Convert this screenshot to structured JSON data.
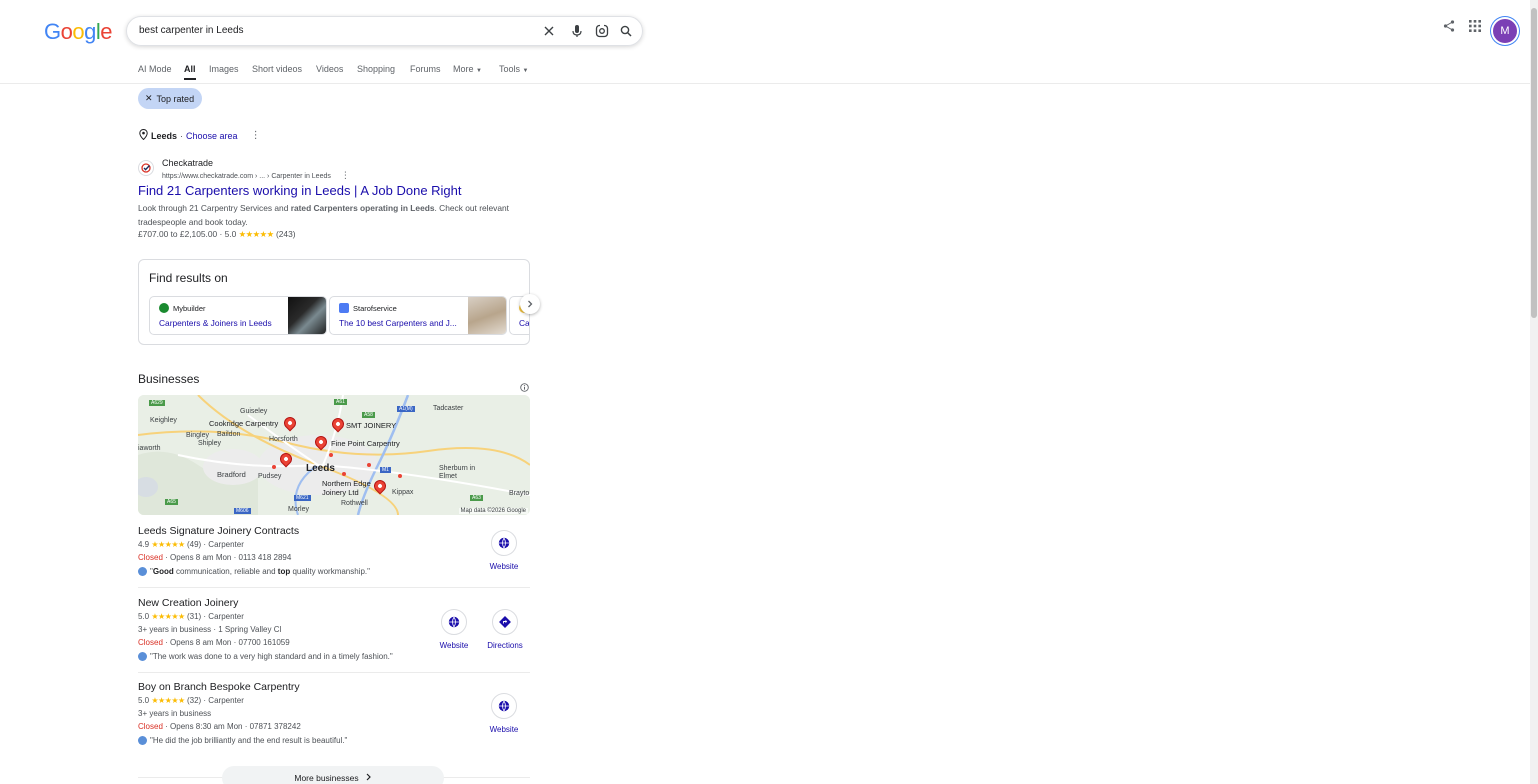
{
  "logo": {
    "text": "Google"
  },
  "search": {
    "query": "best carpenter in Leeds"
  },
  "header": {
    "avatar_letter": "M"
  },
  "tabs": [
    {
      "label": "AI Mode"
    },
    {
      "label": "All"
    },
    {
      "label": "Images"
    },
    {
      "label": "Short videos"
    },
    {
      "label": "Videos"
    },
    {
      "label": "Shopping"
    },
    {
      "label": "Forums"
    },
    {
      "label": "More"
    },
    {
      "label": "Tools"
    }
  ],
  "filter_chip": {
    "label": "Top rated"
  },
  "location": {
    "place": "Leeds",
    "separator": "·",
    "choose": "Choose area"
  },
  "result": {
    "site": "Checkatrade",
    "url": "https://www.checkatrade.com › ... › Carpenter in Leeds",
    "title": "Find 21 Carpenters working in Leeds | A Job Done Right",
    "snippet_a": "Look through 21 Carpentry Services and ",
    "snippet_b": "rated Carpenters operating in Leeds",
    "snippet_c": ". Check out relevant tradespeople and book today.",
    "price": "£707.00 to £2,105.00",
    "rating": "5.0",
    "stars": "★★★★★",
    "count": "(243)"
  },
  "find_results": {
    "title": "Find results on",
    "cards": [
      {
        "source": "Mybuilder",
        "link": "Carpenters & Joiners in Leeds"
      },
      {
        "source": "Starofservice",
        "link": "The 10 best Carpenters and J..."
      },
      {
        "source": "",
        "link": "Ca"
      }
    ]
  },
  "businesses": {
    "title": "Businesses",
    "map_copyright": "Map data ©2026 Google",
    "map_labels": {
      "keighley": "Keighley",
      "guiseley": "Guiseley",
      "cookridge": "Cookridge Carpentry",
      "bingley": "Bingley",
      "baildon": "Baildon",
      "horsforth": "Horsforth",
      "shipley": "Shipley",
      "haworth": "iaworth",
      "bradford": "Bradford",
      "pudsey": "Pudsey",
      "leeds": "Leeds",
      "smt": "SMT JOINERY",
      "finepoint": "Fine Point Carpentry",
      "northern": "Northern Edge Joinery Ltd",
      "kippax": "Kippax",
      "tadcaster": "Tadcaster",
      "sherburn": "Sherburn in Elmet",
      "rothwell": "Rothwell",
      "morley": "Morley",
      "brayton": "Brayto",
      "a660": "A660",
      "a65": "A65",
      "a61": "A61",
      "a58": "A58",
      "a1m": "A1(M)",
      "m1": "M1",
      "m621": "M621",
      "a64": "A64",
      "a629": "A629",
      "m606": "M606",
      "a63": "A63"
    },
    "list": [
      {
        "name": "Leeds Signature Joinery Contracts",
        "rating": "4.9",
        "stars": "★★★★★",
        "count": "(49)",
        "category": "Carpenter",
        "extra": "",
        "status": "Closed",
        "hours": "Opens 8 am Mon",
        "phone": "0113 418 2894",
        "review_a": "\"",
        "review_b1": "Good",
        "review_mid": " communication, reliable and ",
        "review_b2": "top",
        "review_end": " quality workmanship.\"",
        "website": "Website"
      },
      {
        "name": "New Creation Joinery",
        "rating": "5.0",
        "stars": "★★★★★",
        "count": "(31)",
        "category": "Carpenter",
        "extra": "3+ years in business · 1 Spring Valley Cl",
        "status": "Closed",
        "hours": "Opens 8 am Mon",
        "phone": "07700 161059",
        "review": "\"The work was done to a very high standard and in a timely fashion.\"",
        "website": "Website",
        "directions": "Directions"
      },
      {
        "name": "Boy on Branch Bespoke Carpentry",
        "rating": "5.0",
        "stars": "★★★★★",
        "count": "(32)",
        "category": "Carpenter",
        "extra": "3+ years in business",
        "status": "Closed",
        "hours": "Opens 8:30 am Mon",
        "phone": "07871 378242",
        "review": "\"He did the job brilliantly and the end result is beautiful.\"",
        "website": "Website"
      }
    ],
    "more": "More businesses"
  },
  "colors": {
    "link": "#1a0dab",
    "closed": "#d93025",
    "star": "#fbbc04",
    "chip": "#c3d5f5"
  }
}
